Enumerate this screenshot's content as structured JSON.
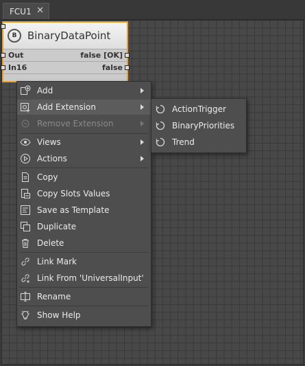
{
  "tab": {
    "title": "FCU1",
    "close_glyph": "✕"
  },
  "component": {
    "title": "BinaryDataPoint",
    "icon_letter": "B",
    "slots": [
      {
        "name": "Out",
        "value": "false [OK]"
      },
      {
        "name": "In16",
        "value": "false"
      }
    ]
  },
  "context_menu": {
    "items": [
      {
        "label": "Add",
        "icon": "add-icon",
        "submenu": true
      },
      {
        "label": "Add Extension",
        "icon": "add-extension-icon",
        "submenu": true,
        "highlighted": true
      },
      {
        "label": "Remove Extension",
        "icon": "remove-extension-icon",
        "submenu": true,
        "disabled": true
      },
      {
        "label": "Views",
        "icon": "eye-icon",
        "submenu": true
      },
      {
        "label": "Actions",
        "icon": "play-icon",
        "submenu": true
      },
      {
        "label": "Copy",
        "icon": "copy-icon"
      },
      {
        "label": "Copy Slots Values",
        "icon": "copy-slots-icon"
      },
      {
        "label": "Save as Template",
        "icon": "save-template-icon"
      },
      {
        "label": "Duplicate",
        "icon": "duplicate-icon"
      },
      {
        "label": "Delete",
        "icon": "trash-icon"
      },
      {
        "label": "Link Mark",
        "icon": "link-icon"
      },
      {
        "label": "Link From 'UniversalInput'",
        "icon": "link-from-icon"
      },
      {
        "label": "Rename",
        "icon": "rename-icon"
      },
      {
        "label": "Show Help",
        "icon": "lightbulb-icon"
      }
    ]
  },
  "extension_submenu": {
    "items": [
      {
        "label": "ActionTrigger",
        "icon": "extension-icon"
      },
      {
        "label": "BinaryPriorities",
        "icon": "extension-icon"
      },
      {
        "label": "Trend",
        "icon": "extension-icon"
      }
    ]
  },
  "colors": {
    "selection_border": "#e8a22b",
    "menu_bg": "#4e4e4e",
    "menu_highlight": "#5c5c5c",
    "canvas_bg": "#484848"
  }
}
